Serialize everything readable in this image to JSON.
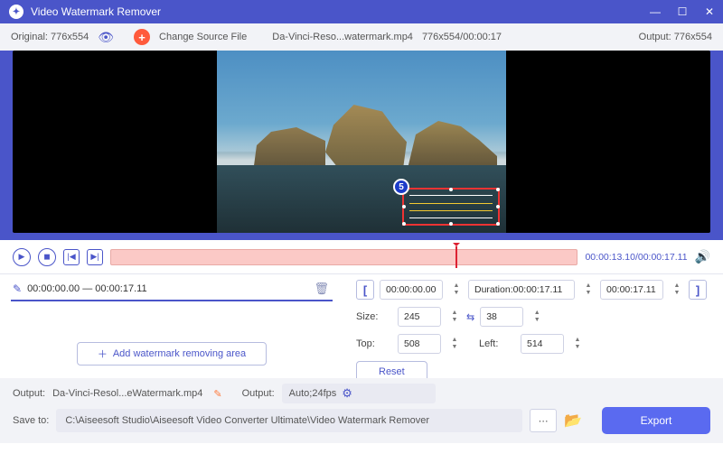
{
  "title": "Video Watermark Remover",
  "annotation": "5",
  "infostrip": {
    "original_label": "Original: 776x554",
    "change_source": "Change Source File",
    "filename": "Da-Vinci-Reso...watermark.mp4",
    "dims_time": "776x554/00:00:17",
    "output_label": "Output: 776x554"
  },
  "playback": {
    "time_current": "00:00:13.10",
    "time_total": "00:00:17.11"
  },
  "segment": {
    "range": "00:00:00.00 — 00:00:17.11"
  },
  "add_area_label": "Add watermark removing area",
  "trim": {
    "start": "00:00:00.00",
    "duration_label": "Duration:00:00:17.11",
    "end": "00:00:17.11"
  },
  "size": {
    "label": "Size:",
    "w": "245",
    "h": "38"
  },
  "pos": {
    "top_label": "Top:",
    "top": "508",
    "left_label": "Left:",
    "left": "514"
  },
  "reset_label": "Reset",
  "output": {
    "out_label": "Output:",
    "out_file": "Da-Vinci-Resol...eWatermark.mp4",
    "fmt_label": "Output:",
    "fmt_value": "Auto;24fps"
  },
  "save": {
    "label": "Save to:",
    "path": "C:\\Aiseesoft Studio\\Aiseesoft Video Converter Ultimate\\Video Watermark Remover"
  },
  "export_label": "Export"
}
